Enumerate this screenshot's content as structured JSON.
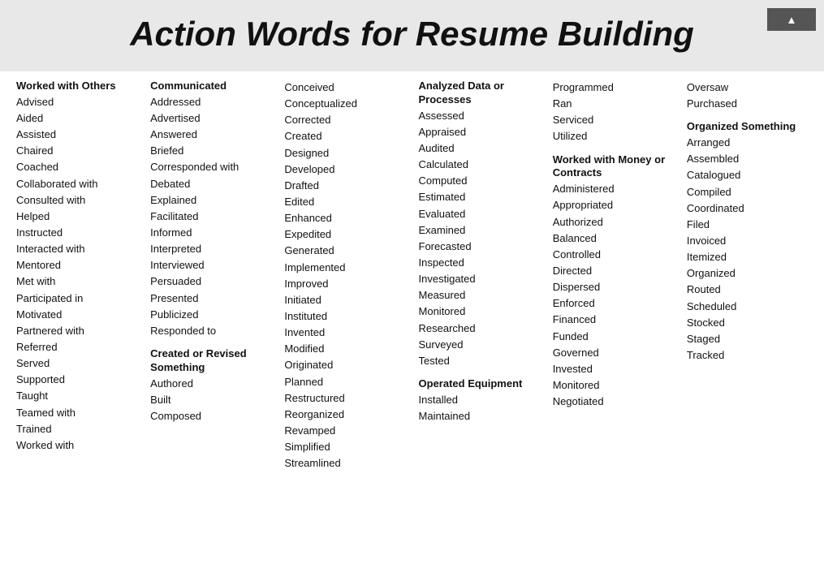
{
  "header": {
    "title": "Action Words for Resume Building",
    "scroll_label": "▲"
  },
  "columns": [
    {
      "sections": [
        {
          "title": "Worked with Others",
          "words": [
            "Advised",
            "Aided",
            "Assisted",
            "Chaired",
            "Coached",
            "Collaborated with",
            "Consulted with",
            "Helped",
            "Instructed",
            "Interacted with",
            "Mentored",
            "Met with",
            "Participated in",
            "Motivated",
            "Partnered with",
            "Referred",
            "Served",
            "Supported",
            "Taught",
            "Teamed with",
            "Trained",
            "Worked with"
          ]
        }
      ]
    },
    {
      "sections": [
        {
          "title": "Communicated",
          "words": [
            "Addressed",
            "Advertised",
            "Answered",
            "Briefed",
            "Corresponded with",
            "Debated",
            "Explained",
            "Facilitated",
            "Informed",
            "Interpreted",
            "Interviewed",
            "Persuaded",
            "Presented",
            "Publicized",
            "Responded to"
          ]
        },
        {
          "title": "Created or Revised Something",
          "words": [
            "Authored",
            "Built",
            "Composed"
          ]
        }
      ]
    },
    {
      "sections": [
        {
          "title": "",
          "words": [
            "Conceived",
            "Conceptualized",
            "Corrected",
            "Created",
            "Designed",
            "Developed",
            "Drafted",
            "Edited",
            "Enhanced",
            "Expedited",
            "Generated",
            "Implemented",
            "Improved",
            "Initiated",
            "Instituted",
            "Invented",
            "Modified",
            "Originated",
            "Planned",
            "Restructured",
            "Reorganized",
            "Revamped",
            "Simplified",
            "Streamlined"
          ]
        }
      ]
    },
    {
      "sections": [
        {
          "title": "Analyzed Data or Processes",
          "words": [
            "Assessed",
            "Appraised",
            "Audited",
            "Calculated",
            "Computed",
            "Estimated",
            "Evaluated",
            "Examined",
            "Forecasted",
            "Inspected",
            "Investigated",
            "Measured",
            "Monitored",
            "Researched",
            "Surveyed",
            "Tested"
          ]
        },
        {
          "title": "Operated Equipment",
          "words": [
            "Installed",
            "Maintained"
          ]
        }
      ]
    },
    {
      "sections": [
        {
          "title": "",
          "words": [
            "Programmed",
            "Ran",
            "Serviced",
            "Utilized"
          ]
        },
        {
          "title": "Worked with Money or Contracts",
          "words": [
            "Administered",
            "Appropriated",
            "Authorized",
            "Balanced",
            "Controlled",
            "Directed",
            "Dispersed",
            "Enforced",
            "Financed",
            "Funded",
            "Governed",
            "Invested",
            "Monitored",
            "Negotiated"
          ]
        }
      ]
    },
    {
      "sections": [
        {
          "title": "",
          "words": [
            "Oversaw",
            "Purchased"
          ]
        },
        {
          "title": "Organized Something",
          "words": [
            "Arranged",
            "Assembled",
            "Catalogued",
            "Compiled",
            "Coordinated",
            "Filed",
            "Invoiced",
            "Itemized",
            "Organized",
            "Routed",
            "Scheduled",
            "Stocked",
            "Staged",
            "Tracked"
          ]
        }
      ]
    }
  ]
}
